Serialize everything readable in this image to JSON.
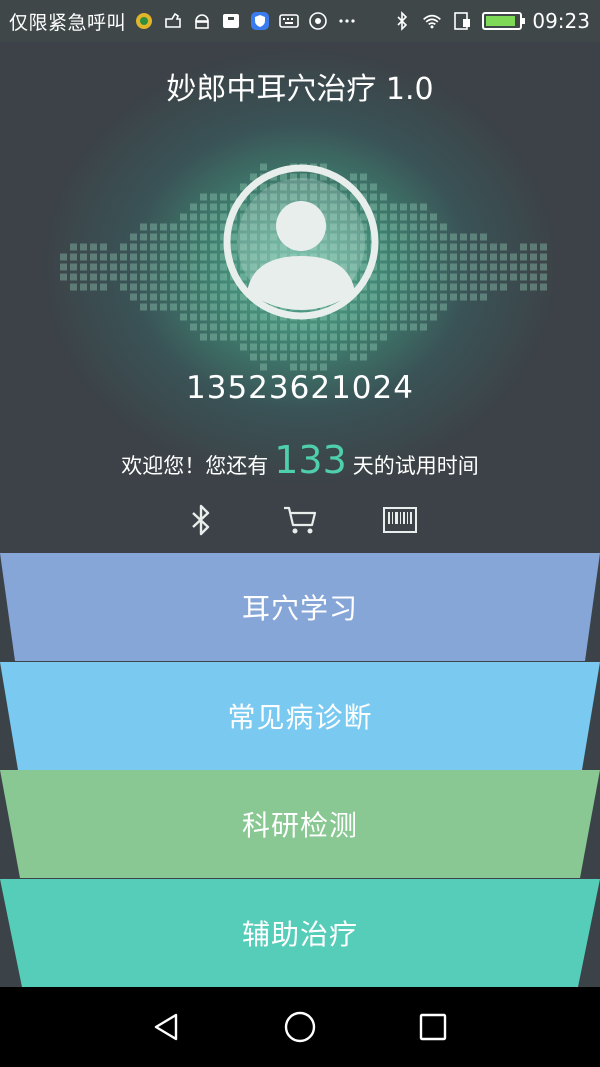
{
  "status_bar": {
    "carrier": "仅限紧急呼叫",
    "time": "09:23",
    "icons": [
      "app-notif-icon",
      "app-notif-icon",
      "android-icon",
      "app-notif-icon",
      "shield-notif-icon",
      "keyboard-icon",
      "app-notif-icon",
      "more-icon"
    ],
    "right_icons": [
      "bluetooth-icon",
      "wifi-icon",
      "sim-icon",
      "battery-icon"
    ]
  },
  "header": {
    "title": "妙郎中耳穴治疗 1.0",
    "phone": "13523621024",
    "trial_prefix": "欢迎您！您还有",
    "trial_days": "133",
    "trial_suffix": "天的试用时间",
    "accent": "#4fd0ad"
  },
  "actions": [
    {
      "icon": "bluetooth-icon"
    },
    {
      "icon": "cart-icon"
    },
    {
      "icon": "barcode-icon"
    }
  ],
  "menu": [
    {
      "label": "耳穴学习",
      "color": "#86a6d8"
    },
    {
      "label": "常见病诊断",
      "color": "#79c9f1"
    },
    {
      "label": "科研检测",
      "color": "#89c793"
    },
    {
      "label": "辅助治疗",
      "color": "#56cdb8"
    }
  ],
  "nav_bar": {
    "buttons": [
      "back-icon",
      "home-icon",
      "recents-icon"
    ]
  }
}
